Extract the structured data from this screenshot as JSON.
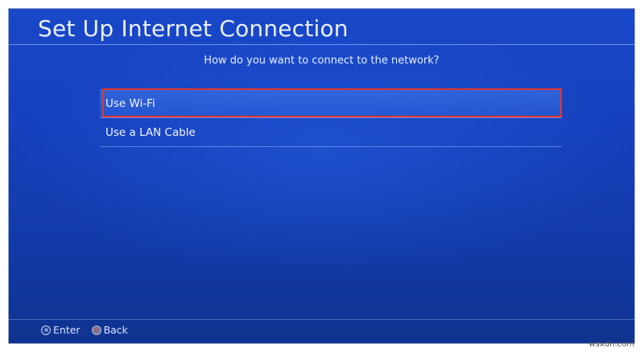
{
  "header": {
    "title": "Set Up Internet Connection"
  },
  "prompt": {
    "question": "How do you want to connect to the network?"
  },
  "options": [
    {
      "label": "Use Wi-Fi",
      "selected": true
    },
    {
      "label": "Use a LAN Cable",
      "selected": false
    }
  ],
  "footer": {
    "enter_label": "Enter",
    "back_label": "Back",
    "enter_icon": "cross-button-icon",
    "back_icon": "circle-button-icon"
  },
  "watermark": "wsxdn.com",
  "colors": {
    "background": "#1644c0",
    "highlight_box": "#e8342c",
    "text": "#ffffff"
  }
}
